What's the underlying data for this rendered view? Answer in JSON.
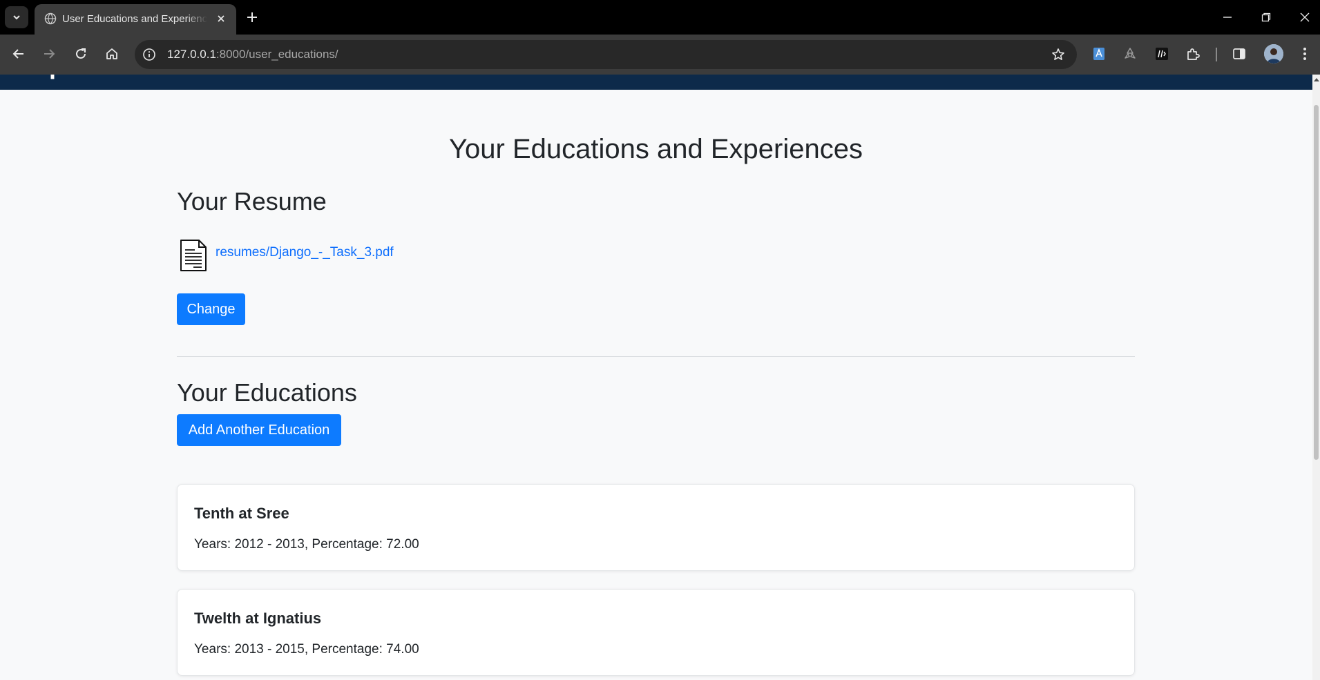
{
  "browser": {
    "tab_title": "User Educations and Experiences",
    "url_host": "127.0.0.1",
    "url_rest": ":8000/user_educations/"
  },
  "site": {
    "brand": "Aspirant"
  },
  "page": {
    "title": "Your Educations and Experiences",
    "resume_heading": "Your Resume",
    "resume_file": "resumes/Django_-_Task_3.pdf",
    "change_button": "Change",
    "educations_heading": "Your Educations",
    "add_education_button": "Add Another Education"
  },
  "educations": [
    {
      "title": "Tenth at Sree",
      "details": "Years: 2012 - 2013, Percentage: 72.00"
    },
    {
      "title": "Twelth at Ignatius",
      "details": "Years: 2013 - 2015, Percentage: 74.00"
    }
  ],
  "colors": {
    "navbar": "#0d2a4a",
    "primary_button": "#0d7bff",
    "link": "#0d6efd",
    "page_background": "#f8f9fa"
  }
}
